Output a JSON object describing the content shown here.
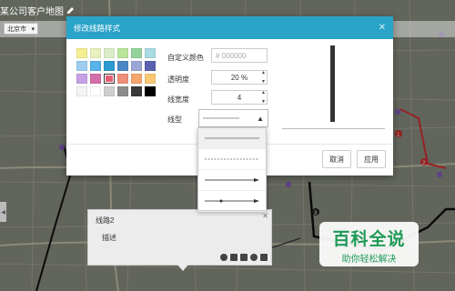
{
  "app": {
    "title": "某公司客户地图",
    "edit_icon": "pencil-icon",
    "city": "北京市"
  },
  "dialog": {
    "title": "修改线路样式",
    "custom_color_label": "自定义颜色",
    "custom_color_placeholder": "# 000000",
    "opacity_label": "透明度",
    "opacity_value": "20",
    "opacity_unit": "%",
    "width_label": "线宽度",
    "width_value": "4",
    "linetype_label": "线型",
    "cancel": "取消",
    "apply": "应用",
    "swatches": [
      "#f5ef8f",
      "#e7f2c0",
      "#dbeec7",
      "#b9e59a",
      "#94d39a",
      "#a9dbe2",
      "#9ccdf0",
      "#59b3ea",
      "#2e99d0",
      "#4d86c4",
      "#9aa6d4",
      "#5a61b0",
      "#c7a0e5",
      "#d56fa9",
      "#e75f74",
      "#ee8f7a",
      "#f4a66f",
      "#f8c873",
      "#f4f4f4",
      "#ffffff",
      "#cfcfcf",
      "#8c8c8c",
      "#3a3a3a",
      "#000000"
    ],
    "line_options": [
      "solid",
      "dashed",
      "arrow",
      "dot-arrow"
    ]
  },
  "card": {
    "title": "线路2",
    "desc": "描述"
  },
  "map_labels": [
    "1",
    "2",
    "3"
  ],
  "watermark": {
    "big": "百科全说",
    "small": "助你轻松解决"
  }
}
